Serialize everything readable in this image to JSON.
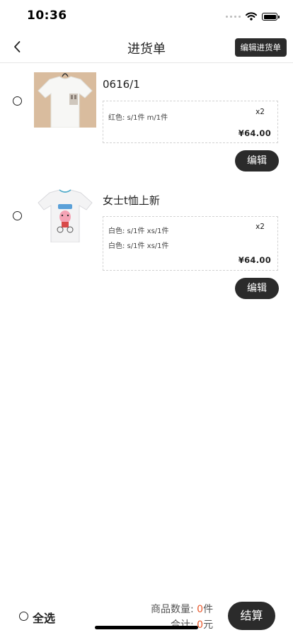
{
  "status_bar": {
    "time": "10:36"
  },
  "nav": {
    "title": "进货单",
    "edit_list_label": "编辑进货单"
  },
  "items": [
    {
      "name": "0616/1",
      "specs": [
        "红色: s/1件 m/1件"
      ],
      "qty": "x2",
      "price": "¥64.00",
      "edit_label": "编辑"
    },
    {
      "name": "女士t恤上新",
      "specs": [
        "白色: s/1件 xs/1件",
        "白色: s/1件 xs/1件"
      ],
      "qty": "x2",
      "price": "¥64.00",
      "edit_label": "编辑"
    }
  ],
  "bottom": {
    "select_all_label": "全选",
    "count_label": "商品数量:",
    "count_value": "0",
    "count_unit": "件",
    "total_label": "合计:",
    "total_value": "0",
    "total_unit": "元",
    "checkout_label": "结算"
  },
  "colors": {
    "accent": "#e8572a",
    "button_dark": "#2b2b2b"
  },
  "icons": [
    "back-chevron-icon",
    "cellular-signal-icon",
    "wifi-icon",
    "battery-icon"
  ]
}
